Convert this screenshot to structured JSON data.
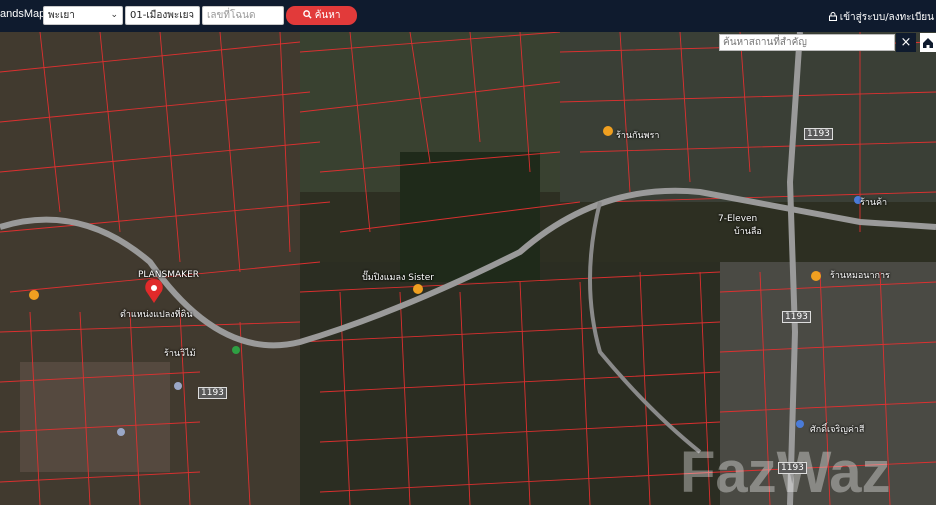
{
  "header": {
    "brand": "andsMaps",
    "province_select": "พะเยา",
    "district_select": "01-เมืองพะเยา",
    "parcel_placeholder": "เลขที่โฉนด",
    "search_button": "ค้นหา",
    "login_link": "เข้าสู่ระบบ/ลงทะเบียน"
  },
  "map": {
    "place_search_placeholder": "ค้นหาสถานที่สำคัญ",
    "close_label": "×",
    "labels": [
      "PLANSMAKER",
      "ตำแหน่งแปลงที่ดิน",
      "ปั๊มปิงแมลง Sister",
      "7-Eleven",
      "ร้านค้า",
      "บ้านลือ",
      "ร้านวิไม้",
      "ร้านกันพรา",
      "ศักดิ์เจริญค่าสี",
      "ร้านหมอนาการ"
    ],
    "road_labels": [
      "1193",
      "1193",
      "1193",
      "1193"
    ],
    "watermark": "FazWaz"
  }
}
